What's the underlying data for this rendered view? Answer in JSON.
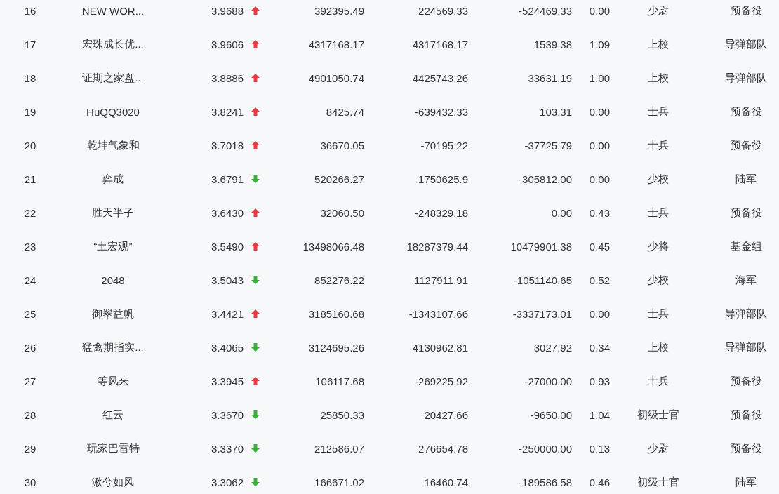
{
  "rows": [
    {
      "rank": "16",
      "name": "NEW WOR...",
      "value": "3.9688",
      "rising": true,
      "column_4": "392395.49",
      "column_5": "224569.33",
      "column_6": "-524469.33",
      "column_7": "0.00",
      "column_8": "少尉",
      "column_9": "预备役"
    },
    {
      "rank": "17",
      "name": "宏珠成长优...",
      "value": "3.9606",
      "rising": true,
      "column_4": "4317168.17",
      "column_5": "4317168.17",
      "column_6": "1539.38",
      "column_7": "1.09",
      "column_8": "上校",
      "column_9": "导弹部队"
    },
    {
      "rank": "18",
      "name": "证期之家盘...",
      "value": "3.8886",
      "rising": true,
      "column_4": "4901050.74",
      "column_5": "4425743.26",
      "column_6": "33631.19",
      "column_7": "1.00",
      "column_8": "上校",
      "column_9": "导弹部队"
    },
    {
      "rank": "19",
      "name": "HuQQ3020",
      "value": "3.8241",
      "rising": true,
      "column_4": "8425.74",
      "column_5": "-639432.33",
      "column_6": "103.31",
      "column_7": "0.00",
      "column_8": "士兵",
      "column_9": "预备役"
    },
    {
      "rank": "20",
      "name": "乾坤气象和",
      "value": "3.7018",
      "rising": true,
      "column_4": "36670.05",
      "column_5": "-70195.22",
      "column_6": "-37725.79",
      "column_7": "0.00",
      "column_8": "士兵",
      "column_9": "预备役"
    },
    {
      "rank": "21",
      "name": "弈成",
      "value": "3.6791",
      "rising": false,
      "column_4": "520266.27",
      "column_5": "1750625.9",
      "column_6": "-305812.00",
      "column_7": "0.00",
      "column_8": "少校",
      "column_9": "陆军"
    },
    {
      "rank": "22",
      "name": "胜天半子",
      "value": "3.6430",
      "rising": true,
      "column_4": "32060.50",
      "column_5": "-248329.18",
      "column_6": "0.00",
      "column_7": "0.43",
      "column_8": "士兵",
      "column_9": "预备役"
    },
    {
      "rank": "23",
      "name": "“土宏观”",
      "value": "3.5490",
      "rising": true,
      "column_4": "13498066.48",
      "column_5": "18287379.44",
      "column_6": "10479901.38",
      "column_7": "0.45",
      "column_8": "少将",
      "column_9": "基金组"
    },
    {
      "rank": "24",
      "name": "2048",
      "value": "3.5043",
      "rising": false,
      "column_4": "852276.22",
      "column_5": "1127911.91",
      "column_6": "-1051140.65",
      "column_7": "0.52",
      "column_8": "少校",
      "column_9": "海军"
    },
    {
      "rank": "25",
      "name": "御翠益帆",
      "value": "3.4421",
      "rising": true,
      "column_4": "3185160.68",
      "column_5": "-1343107.66",
      "column_6": "-3337173.01",
      "column_7": "0.00",
      "column_8": "士兵",
      "column_9": "导弹部队"
    },
    {
      "rank": "26",
      "name": "猛禽期指实...",
      "value": "3.4065",
      "rising": false,
      "column_4": "3124695.26",
      "column_5": "4130962.81",
      "column_6": "3027.92",
      "column_7": "0.34",
      "column_8": "上校",
      "column_9": "导弹部队"
    },
    {
      "rank": "27",
      "name": "等风来",
      "value": "3.3945",
      "rising": true,
      "column_4": "106117.68",
      "column_5": "-269225.92",
      "column_6": "-27000.00",
      "column_7": "0.93",
      "column_8": "士兵",
      "column_9": "预备役"
    },
    {
      "rank": "28",
      "name": "红云",
      "value": "3.3670",
      "rising": false,
      "column_4": "25850.33",
      "column_5": "20427.66",
      "column_6": "-9650.00",
      "column_7": "1.04",
      "column_8": "初级士官",
      "column_9": "预备役"
    },
    {
      "rank": "29",
      "name": "玩家巴雷特",
      "value": "3.3370",
      "rising": false,
      "column_4": "212586.07",
      "column_5": "276654.78",
      "column_6": "-250000.00",
      "column_7": "0.13",
      "column_8": "少尉",
      "column_9": "预备役"
    },
    {
      "rank": "30",
      "name": "湫兮如风",
      "value": "3.3062",
      "rising": false,
      "column_4": "166671.02",
      "column_5": "16460.74",
      "column_6": "-189586.58",
      "column_7": "0.46",
      "column_8": "初级士官",
      "column_9": "陆军"
    }
  ]
}
